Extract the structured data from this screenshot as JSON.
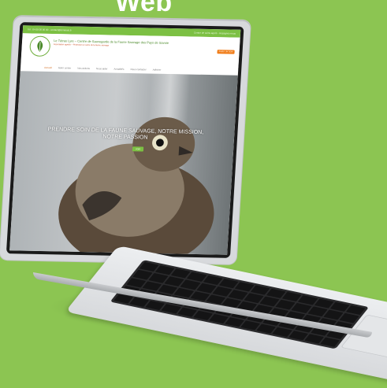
{
  "background_color": "#8cc552",
  "top_word": "Web",
  "site": {
    "topbar": {
      "left": "Tel : 04 00 00 00 00 - contact@lemarais.fr",
      "right": "Centre de soins agréé - Rejoignez-nous"
    },
    "title": "Le Tétras Lyre – Centre de Sauvegarde de la Faune Sauvage des Pays de Savoie",
    "subtitle": "Association agréée – Protection et soins de la faune sauvage",
    "donate": "FAIRE UN DON",
    "nav": [
      "Accueil",
      "Notre centre",
      "Nos actions",
      "Nous aider",
      "Actualités",
      "Nous contacter",
      "Adhérer"
    ],
    "hero": {
      "headline_line1": "PRENDRE SOIN DE LA FAUNE SAUVAGE, NOTRE MISSION,",
      "headline_line2": "NOTRE PASSION",
      "button": "VOIR"
    }
  },
  "icons": [
    "leaf-logo-icon"
  ]
}
